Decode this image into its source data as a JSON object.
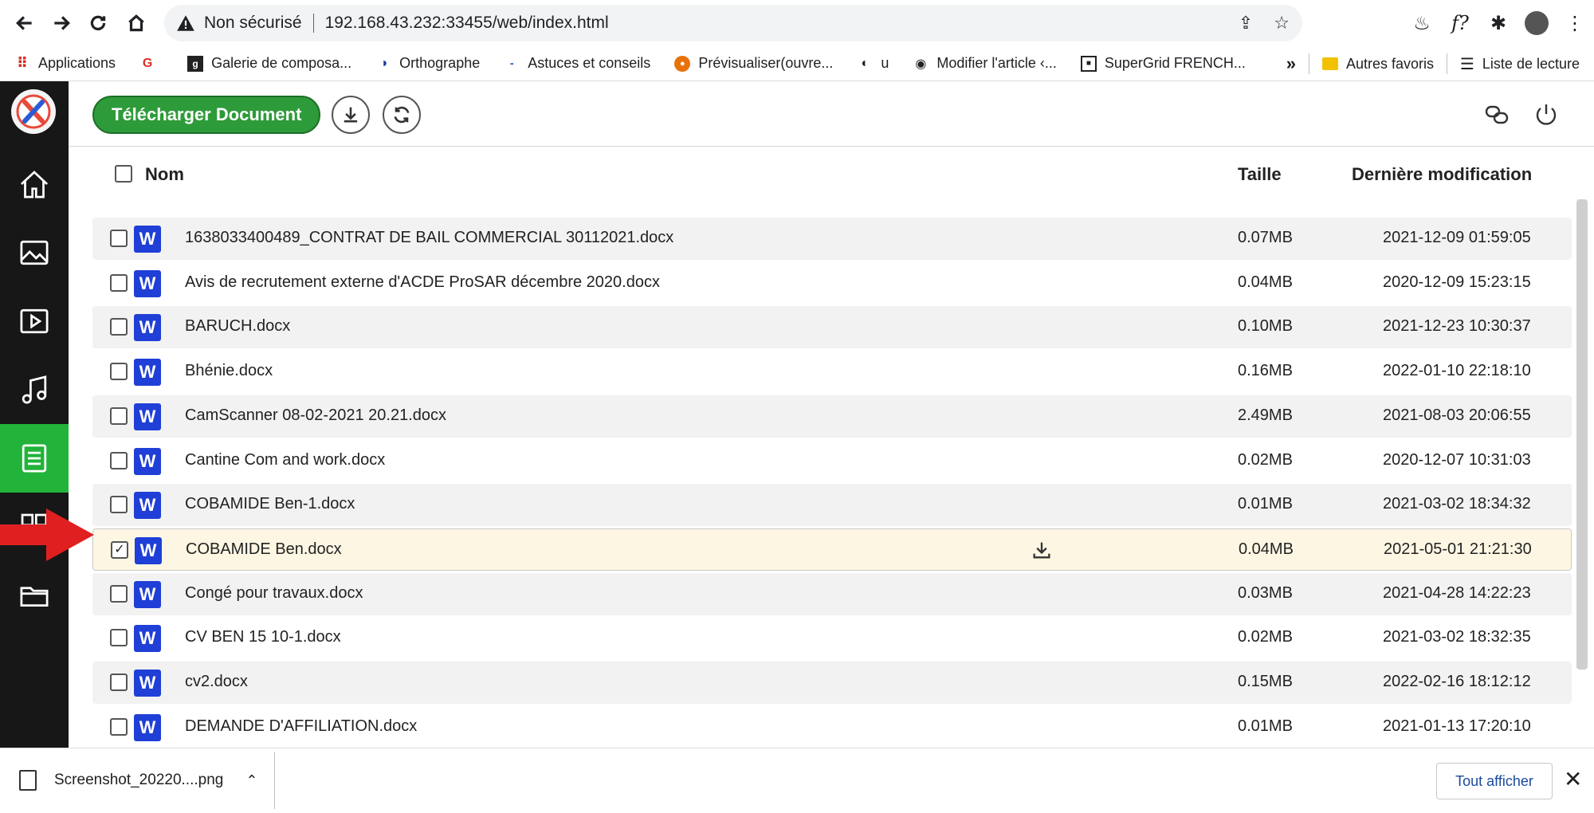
{
  "browser": {
    "security_label": "Non sécurisé",
    "url": "192.168.43.232:33455/web/index.html",
    "bookmarks": [
      {
        "label": "Applications",
        "icon": "apps-grid-icon"
      },
      {
        "label": "",
        "icon": "google-icon"
      },
      {
        "label": "Galerie de composa...",
        "icon": "bookmark-site-icon"
      },
      {
        "label": "Orthographe",
        "icon": "bookmark-site-icon"
      },
      {
        "label": "Astuces et conseils",
        "icon": "bookmark-site-icon"
      },
      {
        "label": "Prévisualiser(ouvre...",
        "icon": "bookmark-site-icon"
      },
      {
        "label": "u",
        "icon": "globe-icon"
      },
      {
        "label": "Modifier l'article ‹...",
        "icon": "wordpress-icon"
      },
      {
        "label": "SuperGrid FRENCH...",
        "icon": "bookmark-site-icon"
      }
    ],
    "other_bookmarks": "Autres favoris",
    "reading_list": "Liste de lecture",
    "overflow": "»"
  },
  "toolbar": {
    "upload_label": "Télécharger Document"
  },
  "table": {
    "headers": {
      "name": "Nom",
      "size": "Taille",
      "modified": "Dernière modification"
    },
    "rows": [
      {
        "name": "1638033400489_CONTRAT DE BAIL COMMERCIAL 30112021.docx",
        "size": "0.07MB",
        "modified": "2021-12-09 01:59:05",
        "checked": false
      },
      {
        "name": "Avis de recrutement externe d'ACDE ProSAR décembre 2020.docx",
        "size": "0.04MB",
        "modified": "2020-12-09 15:23:15",
        "checked": false
      },
      {
        "name": "BARUCH.docx",
        "size": "0.10MB",
        "modified": "2021-12-23 10:30:37",
        "checked": false
      },
      {
        "name": "Bhénie.docx",
        "size": "0.16MB",
        "modified": "2022-01-10 22:18:10",
        "checked": false
      },
      {
        "name": "CamScanner 08-02-2021 20.21.docx",
        "size": "2.49MB",
        "modified": "2021-08-03 20:06:55",
        "checked": false
      },
      {
        "name": "Cantine Com and work.docx",
        "size": "0.02MB",
        "modified": "2020-12-07 10:31:03",
        "checked": false
      },
      {
        "name": "COBAMIDE Ben-1.docx",
        "size": "0.01MB",
        "modified": "2021-03-02 18:34:32",
        "checked": false
      },
      {
        "name": "COBAMIDE Ben.docx",
        "size": "0.04MB",
        "modified": "2021-05-01 21:21:30",
        "checked": true
      },
      {
        "name": "Congé pour travaux.docx",
        "size": "0.03MB",
        "modified": "2021-04-28 14:22:23",
        "checked": false
      },
      {
        "name": "CV BEN 15 10-1.docx",
        "size": "0.02MB",
        "modified": "2021-03-02 18:32:35",
        "checked": false
      },
      {
        "name": "cv2.docx",
        "size": "0.15MB",
        "modified": "2022-02-16 18:12:12",
        "checked": false
      },
      {
        "name": "DEMANDE D'AFFILIATION.docx",
        "size": "0.01MB",
        "modified": "2021-01-13 17:20:10",
        "checked": false
      }
    ],
    "file_icon_letter": "W"
  },
  "downloads": {
    "file": "Screenshot_20220....png",
    "show_all": "Tout afficher"
  },
  "colors": {
    "accent_green": "#2e9b3a",
    "sidebar_bg": "#171717",
    "word_blue": "#1f3fd6",
    "selected_row": "#fdf6e3",
    "arrow_red": "#e02020"
  }
}
